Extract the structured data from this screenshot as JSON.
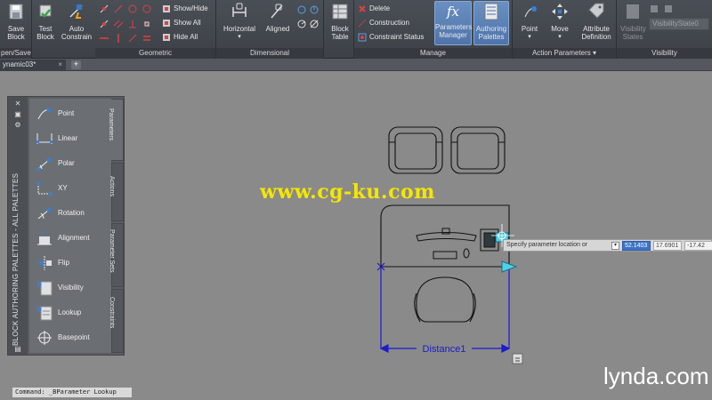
{
  "ribbon": {
    "panels": {
      "open_save": "pen/Save",
      "geometric": "Geometric",
      "dimensional": "Dimensional",
      "manage": "Manage",
      "action_parameters": "Action Parameters",
      "visibility": "Visibility"
    },
    "buttons": {
      "save_block": "Save Block",
      "test_block": "Test Block",
      "auto_constrain": "Auto Constrain",
      "show_hide": "Show/Hide",
      "show_all": "Show All",
      "hide_all": "Hide All",
      "horizontal": "Horizontal",
      "aligned": "Aligned",
      "block_table": "Block Table",
      "delete": "Delete",
      "construction": "Construction",
      "constraint_status": "Constraint Status",
      "parameters_manager": "Parameters Manager",
      "authoring_palettes": "Authoring Palettes",
      "point": "Point",
      "move": "Move",
      "attribute_definition": "Attribute Definition",
      "visibility_states": "Visibility States",
      "visibility_state_value": "VisibilityState0"
    }
  },
  "tabs": {
    "document": "ynamic03*",
    "close": "×",
    "add": "+"
  },
  "palette": {
    "title": "BLOCK AUTHORING PALETTES - ALL PALETTES",
    "items": [
      "Point",
      "Linear",
      "Polar",
      "XY",
      "Rotation",
      "Alignment",
      "Flip",
      "Visibility",
      "Lookup",
      "Basepoint"
    ],
    "tabs": [
      "Parameters",
      "Actions",
      "Parameter Sets",
      "Constraints"
    ]
  },
  "drawing": {
    "dimension_label": "Distance1",
    "prompt": "Specify parameter location or",
    "coord1": "52.1403",
    "coord2": "17.6901",
    "coord3": "-17.42"
  },
  "command_line": "Command: _BParameter Lookup",
  "watermark": "www.cg-ku.com",
  "brand": "lynda.com",
  "colors": {
    "ribbon_bg": "#3d4147",
    "canvas_bg": "#8a8a8a",
    "dimension_blue": "#1c1ccc",
    "grip_cyan": "#4fd0e6",
    "watermark_yellow": "#f5e600"
  }
}
